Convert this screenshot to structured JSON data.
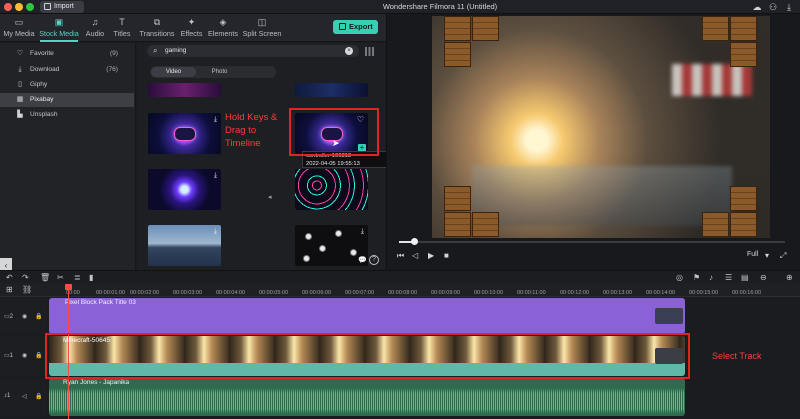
{
  "titlebar": {
    "import_label": "Import",
    "app_title": "Wondershare Filmora 11 (Untitled)"
  },
  "toolbar": {
    "tabs": [
      {
        "label": "My Media",
        "icon": "folder-icon"
      },
      {
        "label": "Stock Media",
        "icon": "stock-media-icon"
      },
      {
        "label": "Audio",
        "icon": "music-note-icon"
      },
      {
        "label": "Titles",
        "icon": "titles-icon"
      },
      {
        "label": "Transitions",
        "icon": "transitions-icon"
      },
      {
        "label": "Effects",
        "icon": "effects-icon"
      },
      {
        "label": "Elements",
        "icon": "elements-icon"
      },
      {
        "label": "Split Screen",
        "icon": "split-screen-icon"
      }
    ],
    "export_label": "Export"
  },
  "sidebar": {
    "items": [
      {
        "label": "Favorite",
        "count": "(9)"
      },
      {
        "label": "Download",
        "count": "(76)"
      },
      {
        "label": "Giphy",
        "count": ""
      },
      {
        "label": "Pixabay",
        "count": ""
      },
      {
        "label": "Unsplash",
        "count": ""
      }
    ]
  },
  "media": {
    "search_value": "gaming",
    "tabs": [
      "Video",
      "Photo"
    ],
    "tooltip_line1": "controller-106313",
    "tooltip_line2": "2022-04-05 19:55:13",
    "annotation": "Hold Keys & Drag to Timeline"
  },
  "preview": {
    "quality": "Full",
    "progress": 0.04
  },
  "ruler": {
    "ticks": [
      "00:00",
      "00:00:01:00",
      "00:00:02:00",
      "00:00:03:00",
      "00:00:04:00",
      "00:00:05:00",
      "00:00:06:00",
      "00:00:07:00",
      "00:00:08:00",
      "00:00:09:00",
      "00:00:10:00",
      "00:00:11:00",
      "00:00:12:00",
      "00:00:13:00",
      "00:00:14:00",
      "00:00:15:00",
      "00:00:16:00"
    ]
  },
  "timeline": {
    "tracks": [
      {
        "number": "2",
        "clip": "Pixel Block Pack Title 03"
      },
      {
        "number": "1",
        "clip": "Minecraft-50645"
      },
      {
        "number": "1",
        "clip": "Ryan Jones - Japanika"
      }
    ],
    "annotation": "Select Track"
  },
  "colors": {
    "accent": "#38d0b4",
    "annotation": "#e02424",
    "title_clip": "#8b61d8",
    "video_clip": "#5fb8a8",
    "audio_clip": "#2f6a4f"
  }
}
